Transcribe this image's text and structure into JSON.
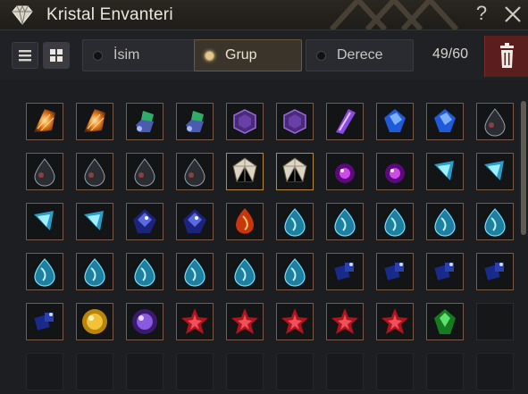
{
  "window": {
    "title": "Kristal Envanteri",
    "help_symbol": "?",
    "title_icon": "diamond-icon",
    "close_icon": "close-icon"
  },
  "toolbar": {
    "view_modes": [
      {
        "name": "list-view",
        "icon": "list-icon",
        "active": false
      },
      {
        "name": "grid-view",
        "icon": "grid-icon",
        "active": true
      }
    ],
    "sort_options": [
      {
        "label": "İsim",
        "selected": false
      },
      {
        "label": "Grup",
        "selected": true
      },
      {
        "label": "Derece",
        "selected": false
      }
    ],
    "count": "49/60",
    "delete_icon": "trash-icon"
  },
  "colors": {
    "accent_gold": "#e6c78b",
    "delete_red": "#5a1e1e",
    "slot_border": "#7a5a4a"
  },
  "inventory": {
    "capacity": 60,
    "rows": [
      [
        "orange-feather",
        "orange-feather",
        "green-blue-gem",
        "green-blue-gem",
        "purple-hex",
        "purple-hex",
        "violet-shard",
        "blue-gem",
        "blue-gem",
        "black-drop"
      ],
      [
        "black-drop",
        "black-drop",
        "black-drop",
        "black-drop",
        "white-gem",
        "white-gem",
        "magenta-orb",
        "magenta-orb",
        "cyan-crystal",
        "cyan-crystal"
      ],
      [
        "cyan-crystal",
        "cyan-crystal",
        "navy-gem",
        "navy-gem",
        "fire-drop",
        "aqua-drop",
        "aqua-drop",
        "aqua-drop",
        "aqua-drop",
        "aqua-drop"
      ],
      [
        "aqua-drop",
        "aqua-drop",
        "aqua-drop",
        "aqua-drop",
        "aqua-drop",
        "aqua-drop",
        "dark-blue-cube",
        "dark-blue-cube",
        "dark-blue-cube",
        "dark-blue-cube"
      ],
      [
        "dark-blue-cube",
        "gold-orb",
        "violet-orb",
        "red-star",
        "red-star",
        "red-star",
        "red-star",
        "red-star",
        "green-gem",
        "empty"
      ],
      [
        "empty",
        "empty",
        "empty",
        "empty",
        "empty",
        "empty",
        "empty",
        "empty",
        "empty",
        "empty"
      ]
    ]
  }
}
